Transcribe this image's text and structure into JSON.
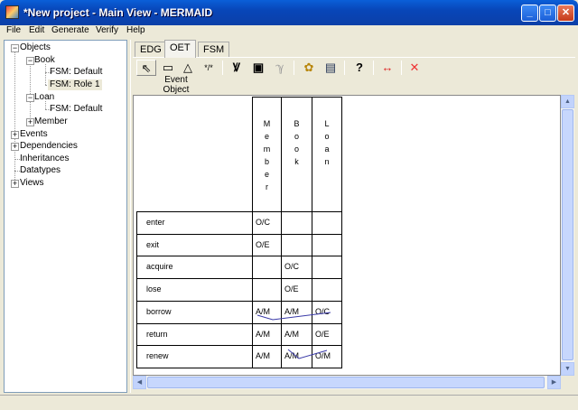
{
  "window": {
    "title": "*New project - Main View - MERMAID",
    "minimize": "_",
    "maximize": "□",
    "close": "✕"
  },
  "menu": [
    "File",
    "Edit",
    "Generate",
    "Verify",
    "Help"
  ],
  "tree": [
    {
      "label": "Objects",
      "toggle": "−"
    },
    {
      "label": "Book",
      "toggle": "−"
    },
    {
      "label": "FSM: Default"
    },
    {
      "label": "FSM: Role 1",
      "selected": true
    },
    {
      "label": "Loan",
      "toggle": "−"
    },
    {
      "label": "FSM: Default"
    },
    {
      "label": "Member",
      "toggle": "+"
    },
    {
      "label": "Events",
      "toggle": "+"
    },
    {
      "label": "Dependencies",
      "toggle": "+"
    },
    {
      "label": "Inheritances"
    },
    {
      "label": "Datatypes"
    },
    {
      "label": "Views",
      "toggle": "+"
    }
  ],
  "tabs": [
    "EDG",
    "OET",
    "FSM"
  ],
  "toolbar": {
    "select": "⇖",
    "event": "▭",
    "object": "△",
    "star": "*/*",
    "t1": "Ꝟ",
    "t2": "▣",
    "t3": "ℽ",
    "img1": "✿",
    "img2": "▤",
    "help": "?",
    "arrow": "↔",
    "delete": "✕",
    "label_line1": "Event",
    "label_line2": "Object"
  },
  "table": {
    "columns": [
      "Member",
      "Book",
      "Loan"
    ],
    "rows": [
      {
        "event": "enter",
        "cells": [
          "O/C",
          "",
          ""
        ]
      },
      {
        "event": "exit",
        "cells": [
          "O/E",
          "",
          ""
        ]
      },
      {
        "event": "acquire",
        "cells": [
          "",
          "O/C",
          ""
        ]
      },
      {
        "event": "lose",
        "cells": [
          "",
          "O/E",
          ""
        ]
      },
      {
        "event": "borrow",
        "cells": [
          "A/M",
          "A/M",
          "O/C"
        ]
      },
      {
        "event": "return",
        "cells": [
          "A/M",
          "A/M",
          "O/E"
        ]
      },
      {
        "event": "renew",
        "cells": [
          "A/M",
          "A/M",
          "O/M"
        ]
      }
    ]
  },
  "scroll": {
    "up": "▲",
    "down": "▼",
    "left": "◀",
    "right": "▶"
  },
  "colors": {
    "link": "#3a3aa8"
  }
}
